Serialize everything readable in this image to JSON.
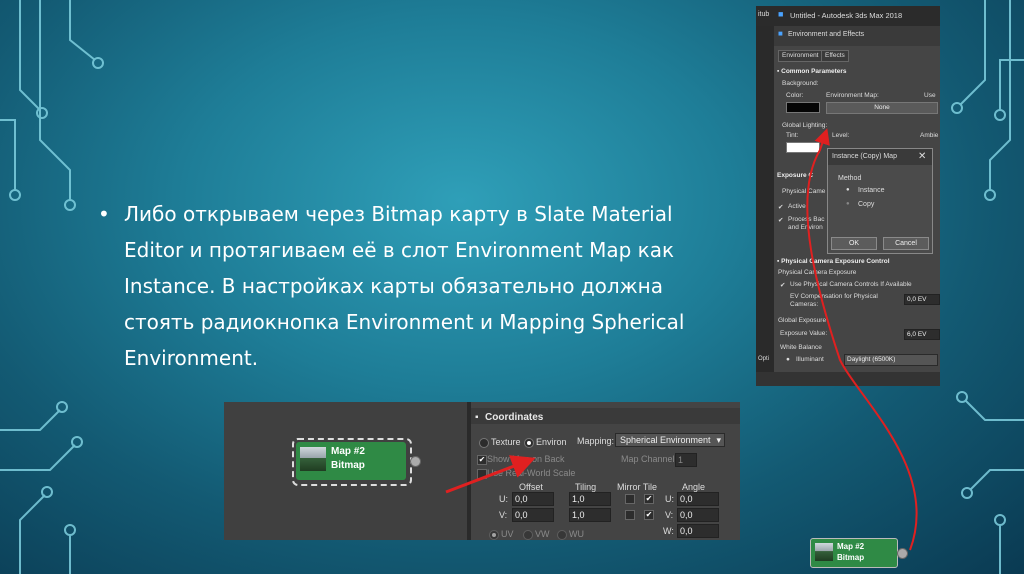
{
  "slide": {
    "bullet": "Либо открываем через Bitmap карту в Slate Material Editor и протягиваем её в слот Environment Map как Instance. В настройках карты обязательно должна стоять радиокнопка Environment и Mapping Spherical Environment.",
    "bullet_marker": "•",
    "bullet_lines": [
      "Либо открываем через Bitmap карту в Slate Material",
      "Editor и протягиваем её в слот Environment Map как",
      "Instance. В настройках карты обязательно должна",
      "стоять радиокнопка Environment и Mapping Spherical",
      "Environment."
    ]
  },
  "slate": {
    "node_title": "Map #2",
    "node_type": "Bitmap",
    "coordinates": {
      "title": "Coordinates",
      "radio_texture": "Texture",
      "radio_environ": "Environ",
      "selected": "Environ",
      "mapping_label": "Mapping:",
      "mapping_value": "Spherical Environment",
      "show_map_on_back": "Show Map on Back",
      "use_real_world_scale": "Use Real-World Scale",
      "map_channel_label": "Map Channel:",
      "map_channel_value": "1",
      "offset_label": "Offset",
      "tiling_label": "Tiling",
      "mirror_tile_label": "Mirror Tile",
      "angle_label": "Angle",
      "u_label": "U:",
      "v_label": "V:",
      "w_label": "W:",
      "u_offset": "0,0",
      "v_offset": "0,0",
      "u_tiling": "1,0",
      "v_tiling": "1,0",
      "u_angle": "0,0",
      "v_angle": "0,0",
      "w_angle": "0,0",
      "uv": "UV",
      "vw": "VW",
      "wu": "WU"
    }
  },
  "max_window": {
    "left_fragment": "itub",
    "title": "Untitled - Autodesk 3ds Max 2018",
    "sub_title": "Environment and Effects",
    "tab_environment": "Environment",
    "tab_effects": "Effects",
    "common_parameters": "Common Parameters",
    "background": "Background:",
    "color": "Color:",
    "environment_map": "Environment Map:",
    "use_fragment": "Use",
    "none_button": "None",
    "global_lighting": "Global Lighting:",
    "tint": "Tint:",
    "level": "Level:",
    "ambient_fragment": "Ambie",
    "exposure_fragment": "Exposure C",
    "physical_camera_fragment": "Physical Came",
    "active": "Active",
    "process_bg_fragment_1": "Process Bac",
    "process_bg_fragment_2": "and Environ",
    "physical_camera_exposure_control": "Physical Camera Exposure Control",
    "physical_camera_exposure": "Physical Camera Exposure",
    "use_physical_camera_controls": "Use Physical Camera Controls If Available",
    "ev_compensation": "EV Compensation for Physical Cameras:",
    "ev_comp_value": "0,0 EV",
    "global_exposure": "Global Exposure",
    "exposure_value_label": "Exposure Value:",
    "exposure_value": "6,0 EV",
    "white_balance": "White Balance",
    "illuminant": "Illuminant",
    "illuminant_value": "Daylight (6500K)",
    "opt_fragment": "Opti"
  },
  "instance_dialog": {
    "title": "Instance (Copy) Map",
    "method": "Method",
    "instance": "Instance",
    "copy": "Copy",
    "selected": "Instance",
    "ok": "OK",
    "cancel": "Cancel"
  },
  "bottom_node": {
    "title": "Map #2",
    "type": "Bitmap"
  },
  "colors": {
    "arrow": "#e02020",
    "node_green": "#2f8a45",
    "slide_bg": "#1e7d97"
  }
}
